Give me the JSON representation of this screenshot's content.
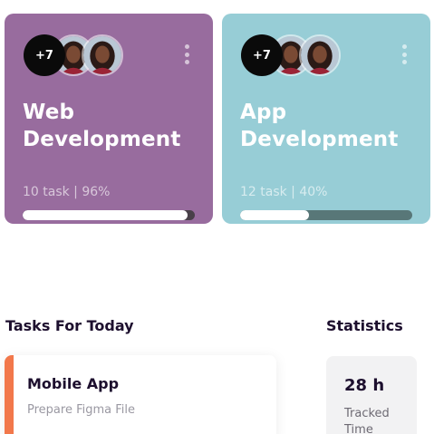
{
  "projects": [
    {
      "title_line1": "Web",
      "title_line2": "Development",
      "meta": "10 task | 96%",
      "progress": 0.96,
      "more_members": "+7",
      "color": "#986c9e"
    },
    {
      "title_line1": "App",
      "title_line2": "Development",
      "meta": "12 task | 40%",
      "progress": 0.4,
      "more_members": "+7",
      "color": "#97cdd6"
    }
  ],
  "tasks_section": {
    "title": "Tasks For Today",
    "task": {
      "title": "Mobile App",
      "subtitle": "Prepare Figma File",
      "accent_color": "#f2784b"
    }
  },
  "stats_section": {
    "title": "Statistics",
    "value": "28 h",
    "label": "Tracked Time"
  },
  "icons": {
    "menu": "more-vertical-icon",
    "avatar": "user-avatar"
  }
}
